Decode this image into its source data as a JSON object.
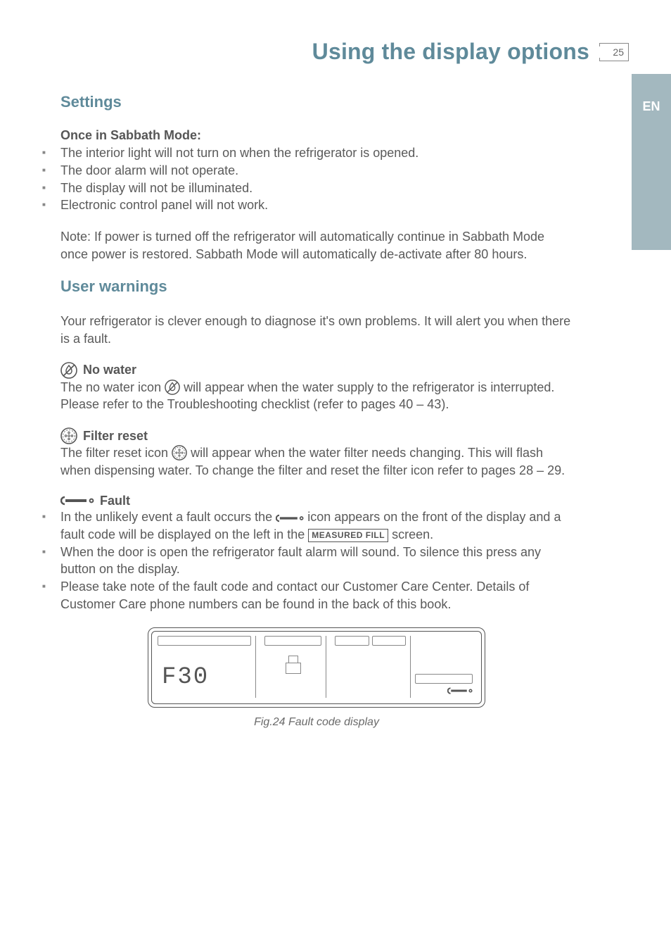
{
  "header": {
    "title": "Using the display options",
    "page_number": "25"
  },
  "lang_tab": "EN",
  "settings": {
    "heading": "Settings",
    "subhead": "Once in Sabbath Mode:",
    "bullets": [
      "The interior light will not turn on when the refrigerator is opened.",
      "The door alarm will not operate.",
      "The display will not be illuminated.",
      "Electronic control panel will not work."
    ],
    "note": "Note: If power is turned off the refrigerator will automatically continue in Sabbath Mode once power is restored. Sabbath Mode will automatically de-activate after 80 hours."
  },
  "warnings": {
    "heading": "User warnings",
    "intro": "Your refrigerator is clever enough to diagnose it's own problems. It will alert you when there is a fault.",
    "no_water": {
      "title": "No water",
      "line1a": "The no water icon ",
      "line1b": " will appear when the water supply to the refrigerator is interrupted. Please refer to the Troubleshooting checklist (refer to pages 40 – 43)."
    },
    "filter": {
      "title": "Filter reset",
      "line1a": "The filter reset icon ",
      "line1b": " will appear when the water filter needs changing. This will flash when dispensing water. To change the filter and reset the filter icon refer to pages 28 – 29."
    },
    "fault": {
      "title": "Fault",
      "b1a": "In the unlikely event a fault occurs the ",
      "b1b": " icon appears on the front of the display and a fault code will be displayed on the left in the ",
      "b1_label": "MEASURED FILL",
      "b1c": " screen.",
      "b2": "When the door is open the refrigerator fault alarm will sound. To silence this press any button on the display.",
      "b3": "Please take note of the fault code and contact our Customer Care Center. Details of Customer Care phone numbers can be found in the back of this book."
    }
  },
  "figure": {
    "code": "F30",
    "caption": "Fig.24 Fault code display"
  }
}
